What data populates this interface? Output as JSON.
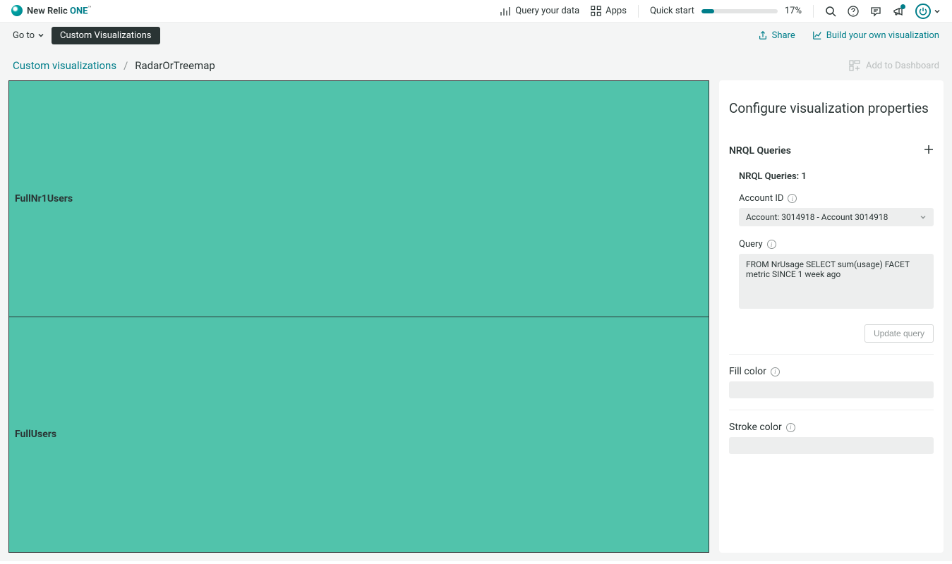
{
  "header": {
    "logo_prefix": "New Relic ",
    "logo_suffix": "ONE",
    "logo_tm": "™",
    "query_label": "Query your data",
    "apps_label": "Apps",
    "quick_start_label": "Quick start",
    "quick_start_percent": "17%"
  },
  "action_bar": {
    "goto_label": "Go to",
    "pill_label": "Custom Visualizations",
    "share_label": "Share",
    "build_label": "Build your own visualization"
  },
  "breadcrumb": {
    "parent": "Custom visualizations",
    "separator": "/",
    "current": "RadarOrTreemap",
    "add_dashboard": "Add to Dashboard"
  },
  "viz": {
    "cell1": "FullNr1Users",
    "cell2": "FullUsers"
  },
  "config": {
    "title": "Configure visualization properties",
    "nrql_header": "NRQL Queries",
    "nrql_count_label": "NRQL Queries: 1",
    "account_label": "Account ID",
    "account_value": "Account: 3014918 - Account 3014918",
    "query_label": "Query",
    "query_value": "FROM NrUsage SELECT sum(usage) FACET metric SINCE 1 week ago",
    "update_btn": "Update query",
    "fill_label": "Fill color",
    "stroke_label": "Stroke color"
  }
}
